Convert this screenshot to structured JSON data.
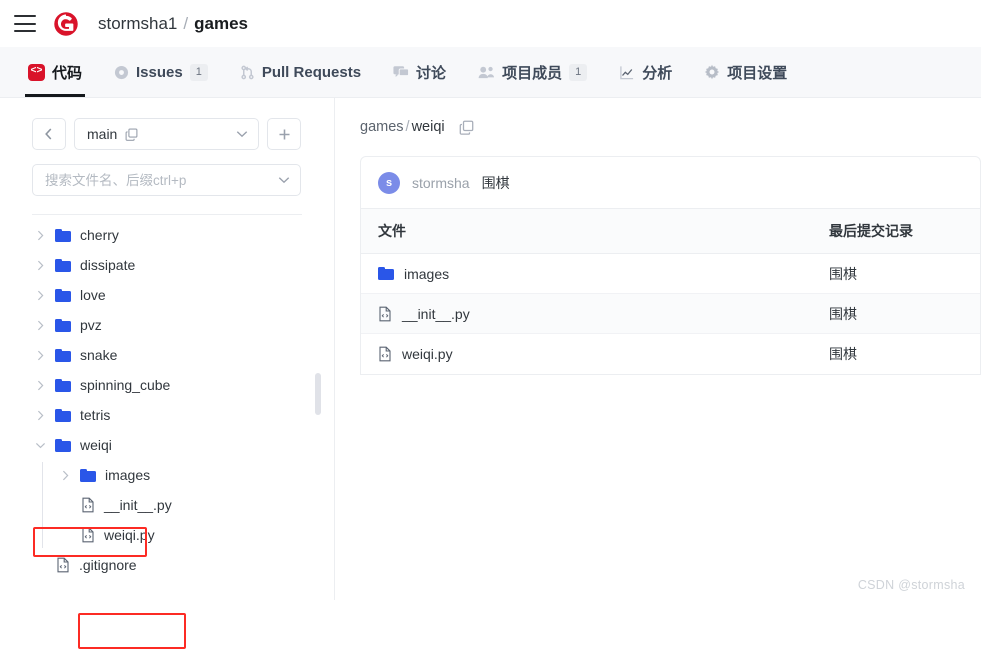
{
  "header": {
    "menu_icon": "hamburger-icon",
    "logo_icon": "gitee-logo-icon",
    "owner": "stormsha1",
    "separator": "/",
    "repo": "games"
  },
  "nav": {
    "items": [
      {
        "label": "代码",
        "icon": "code-icon",
        "badge": null,
        "active": true
      },
      {
        "label": "Issues",
        "icon": "issue-circle-icon",
        "badge": "1",
        "active": false
      },
      {
        "label": "Pull Requests",
        "icon": "pull-request-icon",
        "badge": null,
        "active": false
      },
      {
        "label": "讨论",
        "icon": "comment-icon",
        "badge": null,
        "active": false
      },
      {
        "label": "项目成员",
        "icon": "members-icon",
        "badge": "1",
        "active": false
      },
      {
        "label": "分析",
        "icon": "chart-icon",
        "badge": null,
        "active": false
      },
      {
        "label": "项目设置",
        "icon": "gear-icon",
        "badge": null,
        "active": false
      }
    ]
  },
  "sidebar": {
    "back_icon": "chevron-left-icon",
    "branch": {
      "name": "main",
      "copy_icon": "copy-icon",
      "chevron_icon": "chevron-down-icon"
    },
    "add_button_label": "+",
    "search": {
      "placeholder": "搜索文件名、后缀ctrl+p",
      "value": "",
      "chevron_icon": "chevron-down-icon"
    },
    "tree": [
      {
        "label": "cherry",
        "type": "folder",
        "depth": 0,
        "expanded": false,
        "highlight": false
      },
      {
        "label": "dissipate",
        "type": "folder",
        "depth": 0,
        "expanded": false,
        "highlight": false
      },
      {
        "label": "love",
        "type": "folder",
        "depth": 0,
        "expanded": false,
        "highlight": false
      },
      {
        "label": "pvz",
        "type": "folder",
        "depth": 0,
        "expanded": false,
        "highlight": false
      },
      {
        "label": "snake",
        "type": "folder",
        "depth": 0,
        "expanded": false,
        "highlight": false
      },
      {
        "label": "spinning_cube",
        "type": "folder",
        "depth": 0,
        "expanded": false,
        "highlight": false
      },
      {
        "label": "tetris",
        "type": "folder",
        "depth": 0,
        "expanded": false,
        "highlight": false
      },
      {
        "label": "weiqi",
        "type": "folder",
        "depth": 0,
        "expanded": true,
        "highlight": true
      },
      {
        "label": "images",
        "type": "folder",
        "depth": 1,
        "expanded": false,
        "highlight": false
      },
      {
        "label": "__init__.py",
        "type": "file",
        "depth": 1,
        "expanded": null,
        "highlight": false
      },
      {
        "label": "weiqi.py",
        "type": "file",
        "depth": 1,
        "expanded": null,
        "highlight": true
      },
      {
        "label": ".gitignore",
        "type": "file",
        "depth": 0,
        "expanded": null,
        "highlight": false
      }
    ],
    "highlight_color": "#fc2b24"
  },
  "content": {
    "path": {
      "root": "games",
      "separator": "/",
      "current": "weiqi",
      "copy_icon": "copy-icon"
    },
    "commit": {
      "avatar_initial": "s",
      "author": "stormsha",
      "message": "围棋"
    },
    "table": {
      "columns": [
        "文件",
        "最后提交记录"
      ],
      "rows": [
        {
          "name": "images",
          "icon": "folder-icon",
          "commit": "围棋"
        },
        {
          "name": "__init__.py",
          "icon": "code-file-icon",
          "commit": "围棋"
        },
        {
          "name": "weiqi.py",
          "icon": "code-file-icon",
          "commit": "围棋"
        }
      ]
    }
  },
  "watermark": "CSDN @stormsha"
}
